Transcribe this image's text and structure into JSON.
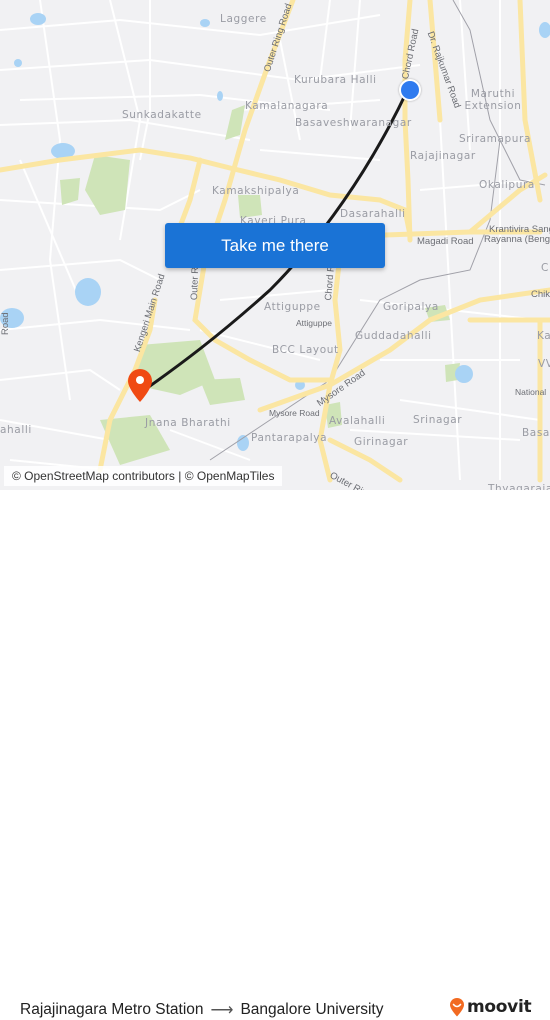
{
  "map": {
    "colors": {
      "background": "#f1f1f3",
      "major_road": "#fbe6a2",
      "minor_road": "#ffffff",
      "park": "#cfe4b8",
      "water": "#a9d3f5",
      "route_line": "#1a1a1a",
      "origin_marker": "#2f7bef",
      "destination_marker": "#f04a13"
    },
    "place_labels": [
      "Laggere",
      "Kurubara Halli",
      "Kamalanagara",
      "Basaveshwaranagar",
      "Sunkadakatte",
      "Maruthi Extension",
      "Sriramapura",
      "Rajajinagar",
      "Okalipura",
      "Kamakshipalya",
      "Kaveri Pura",
      "Dasarahalli",
      "Attiguppe",
      "Goripalya",
      "Guddadahalli",
      "BCC Layout",
      "Jnana Bharathi",
      "Avalahalli",
      "Srinagar",
      "Pantarapalya",
      "Girinagar",
      "ahalli",
      "Basav",
      "Thyagaraja",
      "Ka",
      "VV",
      "C"
    ],
    "road_labels": [
      "Outer Ring Road",
      "Chord Road",
      "Dr. Rajkumar Road",
      "Magadi Road",
      "Krantivira Sang",
      "Rayanna (Benga",
      "Kengeri Main Road",
      "Outer Ring Road",
      "Chord Road",
      "Attiguppe",
      "Mysore Road",
      "Mysore Road",
      "Outer Ring Road",
      "Road",
      "Chik",
      "National"
    ],
    "origin_marker": "origin-dot",
    "destination_marker": "map-pin-icon"
  },
  "cta": {
    "label": "Take me there"
  },
  "attribution": "© OpenStreetMap contributors | © OpenMapTiles",
  "footer": {
    "origin": "Rajajinagara Metro Station",
    "arrow": "⟶",
    "destination": "Bangalore University",
    "brand": "moovit",
    "brand_color": "#f26a21"
  }
}
